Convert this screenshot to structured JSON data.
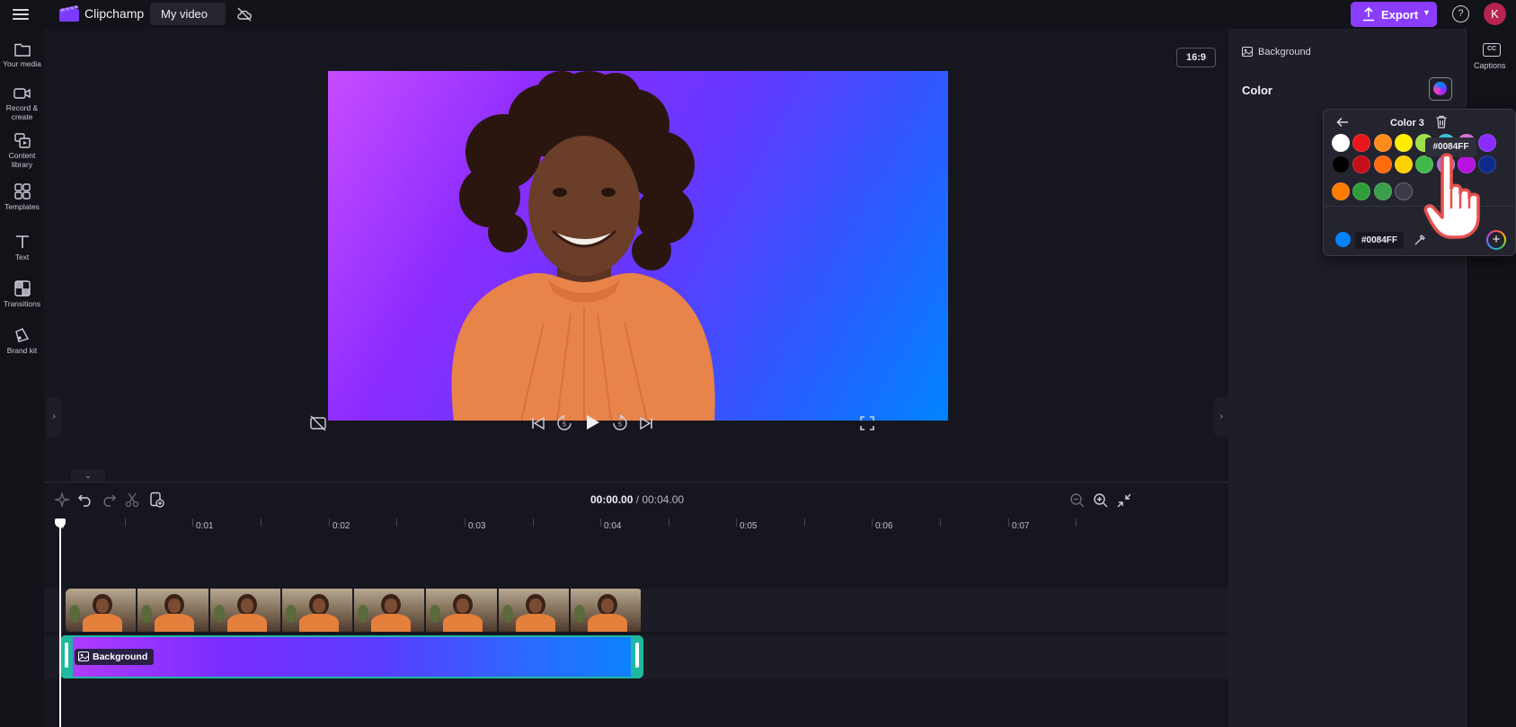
{
  "app": {
    "name": "Clipchamp",
    "project_name": "My video",
    "export_label": "Export",
    "avatar_initial": "K"
  },
  "sidebar": {
    "items": [
      {
        "label": "Your media",
        "icon": "folder-icon"
      },
      {
        "label": "Record &\ncreate",
        "icon": "camera-icon"
      },
      {
        "label": "Content\nlibrary",
        "icon": "library-icon"
      },
      {
        "label": "Templates",
        "icon": "templates-icon"
      },
      {
        "label": "Text",
        "icon": "text-icon"
      },
      {
        "label": "Transitions",
        "icon": "transitions-icon"
      },
      {
        "label": "Brand kit",
        "icon": "brand-kit-icon"
      }
    ]
  },
  "preview": {
    "aspect_ratio": "16:9",
    "background_gradient": [
      "#c84cff",
      "#6438ff",
      "#0084ff"
    ]
  },
  "timeline": {
    "current_time": "00:00.00",
    "total_time": "/ 00:04.00",
    "ticks": [
      "0",
      "0:01",
      "0:02",
      "0:03",
      "0:04",
      "0:05",
      "0:06",
      "0:07"
    ],
    "background_clip_label": "Background",
    "video_thumbnail_count": 8
  },
  "properties": {
    "section_title": "Background",
    "color_label": "Color"
  },
  "right_rail": {
    "captions_label": "Captions"
  },
  "color_picker": {
    "title": "Color 3",
    "tooltip": "#0084FF",
    "hex_value": "#0084FF",
    "current_color": "#0084FF",
    "swatches": [
      [
        "#ffffff",
        "#e8151b",
        "#ff8a1c",
        "#ffee00",
        "#9ee04a",
        "#2ec1d6",
        "#d66cd6",
        "#8a2cff"
      ],
      [
        "#000000",
        "#c40f16",
        "#ff6a0d",
        "#ffd000",
        "#43b84a",
        "#b16ed1",
        "#b712e0",
        "#0e2a8a"
      ],
      [
        "#ff7a00",
        "#2f9e3a",
        "#3a9e4a",
        "empty"
      ]
    ]
  },
  "colors": {
    "accent": "#8b3dff",
    "clip_border": "#1fb8a0",
    "panel_bg": "#1e1e28",
    "app_bg": "#16161f"
  }
}
